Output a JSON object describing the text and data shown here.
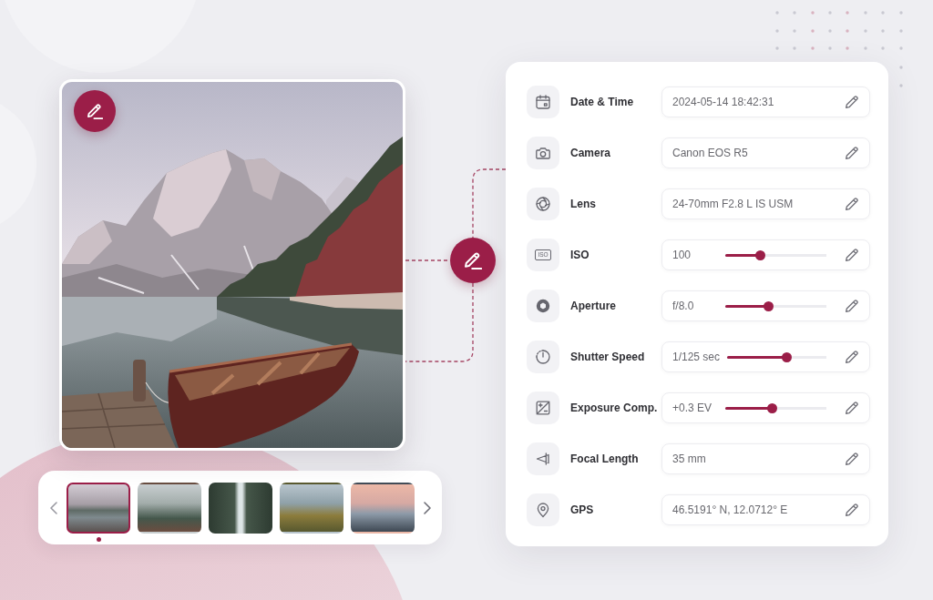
{
  "gallery": {
    "thumbnails": [
      {
        "selected": true
      },
      {
        "selected": false
      },
      {
        "selected": false
      },
      {
        "selected": false
      },
      {
        "selected": false
      }
    ]
  },
  "metadata": {
    "fields": [
      {
        "label": "Date & Time",
        "value": "2024-05-14 18:42:31",
        "kind": "text"
      },
      {
        "label": "Camera",
        "value": "Canon EOS R5",
        "kind": "text"
      },
      {
        "label": "Lens",
        "value": "24-70mm F2.8 L IS USM",
        "kind": "text"
      },
      {
        "label": "ISO",
        "icon_text": "ISO",
        "value": "100",
        "kind": "slider",
        "level": 0.35
      },
      {
        "label": "Aperture",
        "value": "f/8.0",
        "kind": "slider",
        "level": 0.43
      },
      {
        "label": "Shutter Speed",
        "value": "1/125 sec",
        "kind": "slider",
        "level": 0.6
      },
      {
        "label": "Exposure Comp.",
        "value": "+0.3 EV",
        "kind": "slider",
        "level": 0.46
      },
      {
        "label": "Focal Length",
        "value": "35 mm",
        "kind": "text"
      },
      {
        "label": "GPS",
        "value": "46.5191° N, 12.0712° E",
        "kind": "text"
      }
    ]
  }
}
